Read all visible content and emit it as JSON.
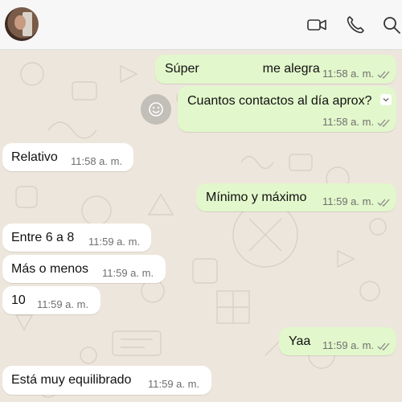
{
  "chat": {
    "messages": [
      {
        "direction": "out",
        "text_before": "Súper",
        "text_after": "me alegra",
        "time": "11:58 a. m."
      },
      {
        "direction": "out",
        "text": "Cuantos contactos al día aprox?",
        "time": "11:58 a. m."
      },
      {
        "direction": "in",
        "text": "Relativo",
        "time": "11:58 a. m."
      },
      {
        "direction": "out",
        "text": "Mínimo y máximo",
        "time": "11:59 a. m."
      },
      {
        "direction": "in",
        "text": "Entre 6 a 8",
        "time": "11:59 a. m."
      },
      {
        "direction": "in",
        "text": "Más o menos",
        "time": "11:59 a. m."
      },
      {
        "direction": "in",
        "text": "10",
        "time": "11:59 a. m."
      },
      {
        "direction": "out",
        "text": "Yaa",
        "time": "11:59 a. m."
      },
      {
        "direction": "in",
        "text": "Está muy equilibrado",
        "time": "11:59 a. m."
      }
    ]
  },
  "icons": {
    "video": "video-camera-icon",
    "call": "phone-icon",
    "search": "search-icon",
    "emoji": "emoji-icon",
    "read_receipt": "double-check-icon",
    "menu": "chevron-down-icon"
  },
  "colors": {
    "outgoing_bubble": "#e2f7cb",
    "incoming_bubble": "#ffffff",
    "chat_background": "#ede6dc",
    "header_background": "#f7f7f7",
    "timestamp": "#6f6f6f"
  }
}
